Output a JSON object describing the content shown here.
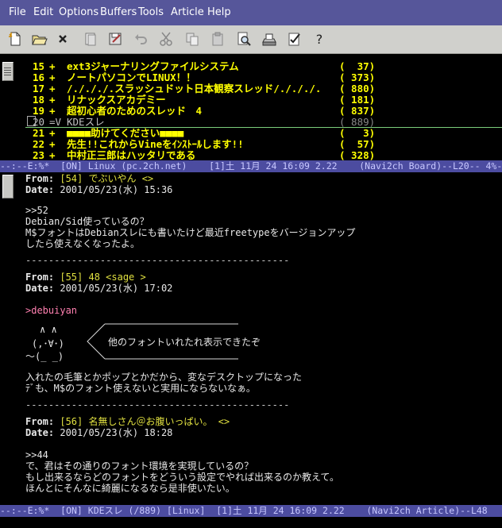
{
  "menu": [
    "File",
    "Edit",
    "Options",
    "Buffers",
    "Tools",
    "Article",
    "Help"
  ],
  "toolbar_icons": [
    "new-file-icon",
    "open-folder-icon",
    "close-x-icon",
    "dired-icon",
    "save-icon",
    "undo-icon",
    "cut-icon",
    "copy-icon",
    "paste-icon",
    "search-icon",
    "print-icon",
    "spell-check-icon",
    "help-icon"
  ],
  "colors": {
    "menubar": "#56569a",
    "modeline": "#4c4ca0",
    "board_title": "#ffff00",
    "article_header": "#e0e040",
    "quote": "#ff80b0"
  },
  "board": {
    "rows": [
      {
        "num": "15",
        "mark": "+",
        "title": "ext3ジャーナリングファイルシステム",
        "count": "(  37)"
      },
      {
        "num": "16",
        "mark": "+",
        "title": "ノートパソコンでLINUX！！",
        "count": "( 373)"
      },
      {
        "num": "17",
        "mark": "+",
        "title": "/./././.スラッシュドット日本観察スレッド/./././.",
        "count": "( 880)"
      },
      {
        "num": "18",
        "mark": "+",
        "title": "リナックスアカデミー",
        "count": "( 181)"
      },
      {
        "num": "19",
        "mark": "+",
        "title": "超初心者のためのスレッド　4",
        "count": "( 837)"
      },
      {
        "num": "20",
        "mark": "=V",
        "title": "KDEスレ",
        "count": "( 889)"
      },
      {
        "num": "21",
        "mark": "+",
        "title": "■■■■助けてください■■■■",
        "count": "(   3)"
      },
      {
        "num": "22",
        "mark": "+",
        "title": "先生!!これからVineをｲﾝｽﾄｰﾙします!!",
        "count": "(  57)"
      },
      {
        "num": "23",
        "mark": "+",
        "title": "中村正三郎はハッタリである",
        "count": "( 328)"
      }
    ]
  },
  "modeline_board": "--:--E:%*  [ON] Linux (pc.2ch.net)    [1]土 11月 24 16:09 2.22    (Navi2ch Board)--L20-- 4%-",
  "modeline_article": "--:--E:%*  [ON] KDEスレ (/889) [Linux]  [1]土 11月 24 16:09 2.22    (Navi2ch Article)--L48",
  "article": {
    "label_from": "From:",
    "label_date": "Date:",
    "posts": [
      {
        "from": "[54] でぶいやん <>",
        "date": "2001/05/23(水) 15:36",
        "body": [
          ">>52",
          "Debian/Sid使っているの？",
          "M$フォントはDebianスレにも書いたけど最近freetypeをバージョンアップ",
          "したら使えなくなったよ。"
        ]
      },
      {
        "from": "[55] 48 <sage >",
        "date": "2001/05/23(水) 17:02",
        "quote": ">debuiyan",
        "aa": {
          "l1": "∧ ∧",
          "l2": "(,･∀･)",
          "l3": "～(_ _)",
          "speech": "他のフォントいれたれ表示できたぞ"
        },
        "body": [
          "入れたの毛筆とかポップとかだから、変なデスクトップになった",
          "ﾃﾞも、M$のフォント使えないと実用にならないなぁ。"
        ]
      },
      {
        "from": "[56] 名無しさん＠お腹いっぱい。 <>",
        "date": "2001/05/23(水) 18:28",
        "body": [
          ">>44",
          "で、君はその通りのフォント環境を実現しているの？",
          "もし出来るならどのフォントをどういう設定でやれば出来るのか教えて。",
          "ほんとにそんなに綺麗になるなら是非使いたい。"
        ]
      }
    ],
    "separator": "----------------------------------------------"
  }
}
